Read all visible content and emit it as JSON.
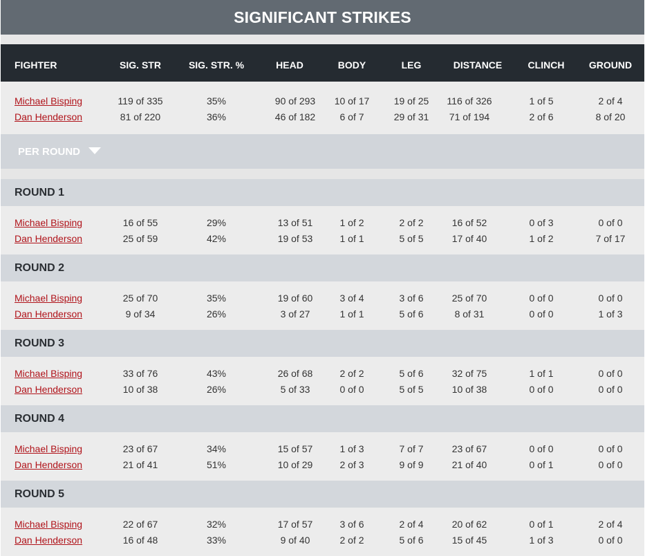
{
  "title": "SIGNIFICANT STRIKES",
  "headers": [
    "FIGHTER",
    "SIG. STR",
    "SIG. STR. %",
    "HEAD",
    "BODY",
    "LEG",
    "DISTANCE",
    "CLINCH",
    "GROUND"
  ],
  "totals": [
    [
      "Michael Bisping",
      "119 of 335",
      "35%",
      "90 of 293",
      "10 of 17",
      "19 of 25",
      "116 of 326",
      "1 of 5",
      "2 of 4"
    ],
    [
      "Dan Henderson",
      "81 of 220",
      "36%",
      "46 of 182",
      "6 of 7",
      "29 of 31",
      "71 of 194",
      "2 of 6",
      "8 of 20"
    ]
  ],
  "per_round_label": "PER ROUND",
  "rounds": [
    {
      "label": "ROUND 1",
      "rows": [
        [
          "Michael Bisping",
          "16 of 55",
          "29%",
          "13 of 51",
          "1 of 2",
          "2 of 2",
          "16 of 52",
          "0 of 3",
          "0 of 0"
        ],
        [
          "Dan Henderson",
          "25 of 59",
          "42%",
          "19 of 53",
          "1 of 1",
          "5 of 5",
          "17 of 40",
          "1 of 2",
          "7 of 17"
        ]
      ]
    },
    {
      "label": "ROUND 2",
      "rows": [
        [
          "Michael Bisping",
          "25 of 70",
          "35%",
          "19 of 60",
          "3 of 4",
          "3 of 6",
          "25 of 70",
          "0 of 0",
          "0 of 0"
        ],
        [
          "Dan Henderson",
          "9 of 34",
          "26%",
          "3 of 27",
          "1 of 1",
          "5 of 6",
          "8 of 31",
          "0 of 0",
          "1 of 3"
        ]
      ]
    },
    {
      "label": "ROUND 3",
      "rows": [
        [
          "Michael Bisping",
          "33 of 76",
          "43%",
          "26 of 68",
          "2 of 2",
          "5 of 6",
          "32 of 75",
          "1 of 1",
          "0 of 0"
        ],
        [
          "Dan Henderson",
          "10 of 38",
          "26%",
          "5 of 33",
          "0 of 0",
          "5 of 5",
          "10 of 38",
          "0 of 0",
          "0 of 0"
        ]
      ]
    },
    {
      "label": "ROUND 4",
      "rows": [
        [
          "Michael Bisping",
          "23 of 67",
          "34%",
          "15 of 57",
          "1 of 3",
          "7 of 7",
          "23 of 67",
          "0 of 0",
          "0 of 0"
        ],
        [
          "Dan Henderson",
          "21 of 41",
          "51%",
          "10 of 29",
          "2 of 3",
          "9 of 9",
          "21 of 40",
          "0 of 1",
          "0 of 0"
        ]
      ]
    },
    {
      "label": "ROUND 5",
      "rows": [
        [
          "Michael Bisping",
          "22 of 67",
          "32%",
          "17 of 57",
          "3 of 6",
          "2 of 4",
          "20 of 62",
          "0 of 1",
          "2 of 4"
        ],
        [
          "Dan Henderson",
          "16 of 48",
          "33%",
          "9 of 40",
          "2 of 2",
          "5 of 6",
          "15 of 45",
          "1 of 3",
          "0 of 0"
        ]
      ]
    }
  ]
}
